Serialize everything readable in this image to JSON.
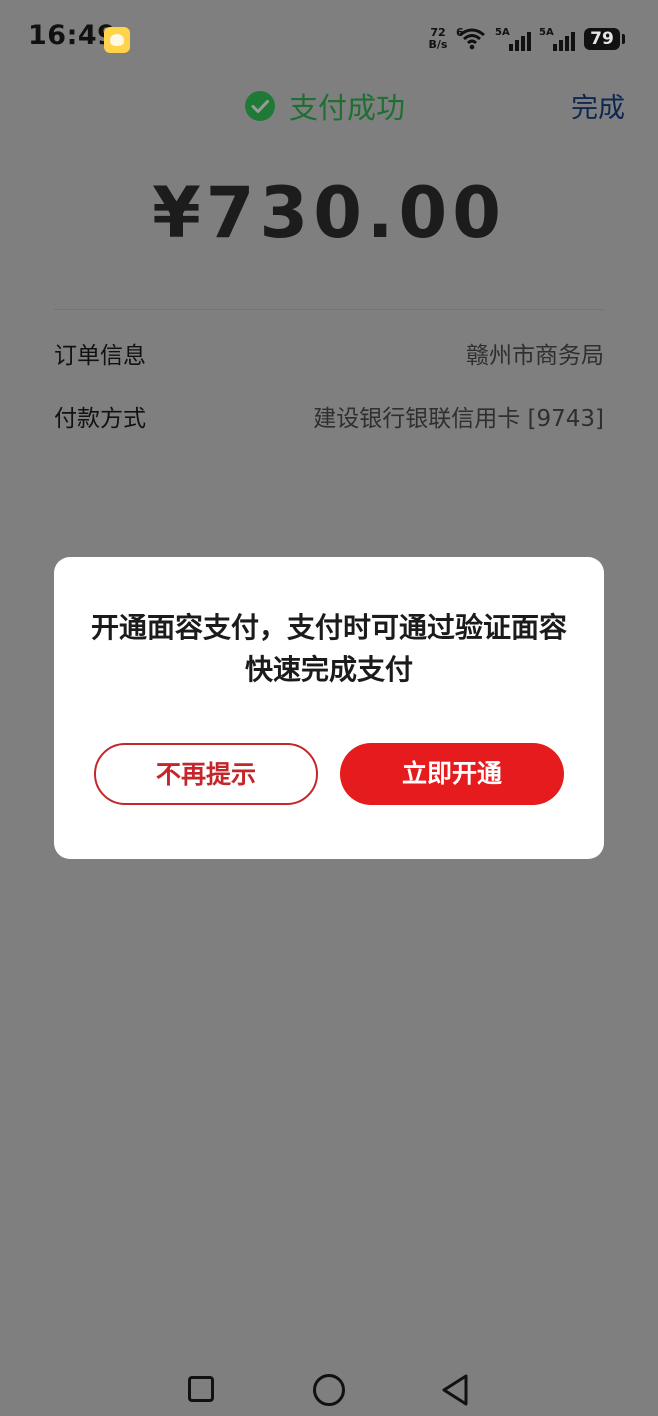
{
  "status_bar": {
    "time": "16:49",
    "net_speed_value": "72",
    "net_speed_unit": "B/s",
    "wifi_label": "6",
    "signal1_label": "5A",
    "signal2_label": "5A",
    "battery": "79"
  },
  "header": {
    "title": "支付成功",
    "done_label": "完成"
  },
  "amount": "¥730.00",
  "details": {
    "order_label": "订单信息",
    "order_value": "赣州市商务局",
    "payment_label": "付款方式",
    "payment_value": "建设银行银联信用卡 [9743]"
  },
  "dialog": {
    "message": "开通面容支付，支付时可通过验证面容快速完成支付",
    "dismiss_label": "不再提示",
    "enable_label": "立即开通"
  },
  "colors": {
    "success_green": "#1f6f33",
    "primary_red": "#e51b1d",
    "overlay_gray": "#7f7f7f"
  }
}
